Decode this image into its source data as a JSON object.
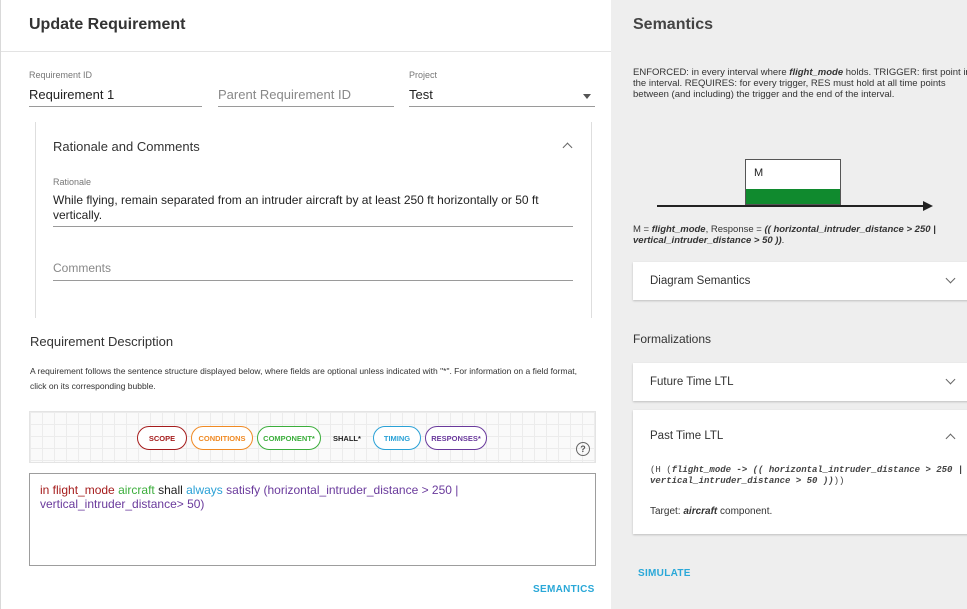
{
  "dialog": {
    "title": "Update Requirement",
    "fields": {
      "req_id_label": "Requirement ID",
      "req_id_value": "Requirement 1",
      "parent_placeholder": "Parent Requirement ID",
      "project_label": "Project",
      "project_value": "Test"
    },
    "rationale": {
      "header": "Rationale and Comments",
      "rationale_label": "Rationale",
      "rationale_value": "While flying, remain separated from an intruder aircraft by at least 250 ft horizontally or 50 ft vertically.",
      "comments_placeholder": "Comments"
    },
    "description": {
      "title": "Requirement Description",
      "text": "A requirement follows the sentence structure displayed below, where fields are optional unless indicated with \"*\". For information on a field format, click on its corresponding bubble."
    },
    "bubbles": {
      "scope": "SCOPE",
      "conditions": "CONDITIONS",
      "component": "COMPONENT*",
      "shall": "SHALL*",
      "timing": "TIMING",
      "responses": "RESPONSES*",
      "help": "?"
    },
    "requirement_text": {
      "scope": "in flight_mode",
      "component": "aircraft",
      "shall": "shall",
      "timing": "always",
      "response": "satisfy (horizontal_intruder_distance > 250 | vertical_intruder_distance> 50)"
    },
    "semantics_button": "SEMANTICS"
  },
  "semantics": {
    "title": "Semantics",
    "desc": {
      "p1": "ENFORCED: in every interval where ",
      "mode": "flight_mode",
      "p2": " holds. TRIGGER: first point in the interval. REQUIRES: for every trigger, RES must hold at all time points between (and including) the trigger and the end of the interval."
    },
    "diagram_label": "M",
    "mapping": {
      "p1": "M = ",
      "mode": "flight_mode",
      "p2": ", Response = ",
      "response": "(( horizontal_intruder_distance > 250 | vertical_intruder_distance > 50 ))",
      "p3": "."
    },
    "diagram_semantics": "Diagram Semantics",
    "formalizations": "Formalizations",
    "future_ltl": "Future Time LTL",
    "past_ltl": {
      "title": "Past Time LTL",
      "f1": "(H (",
      "f2": "flight_mode -> (( horizontal_intruder_distance > 250 | vertical_intruder_distance > 50 ))",
      "f3": "))",
      "target_label": "Target: ",
      "target_value": "aircraft",
      "target_suffix": " component."
    },
    "simulate_button": "SIMULATE"
  },
  "colors": {
    "scope": "#a51c1c",
    "conditions": "#f08a24",
    "component": "#3cae3c",
    "timing": "#2aa1d6",
    "responses": "#6a3a9c",
    "accent": "#2aa8d8",
    "diagram_green": "#108a2e"
  },
  "icons": {
    "collapse": "chevron-up-icon",
    "expand": "chevron-down-icon",
    "dropdown": "caret-down-icon",
    "help": "help-circle-icon"
  }
}
